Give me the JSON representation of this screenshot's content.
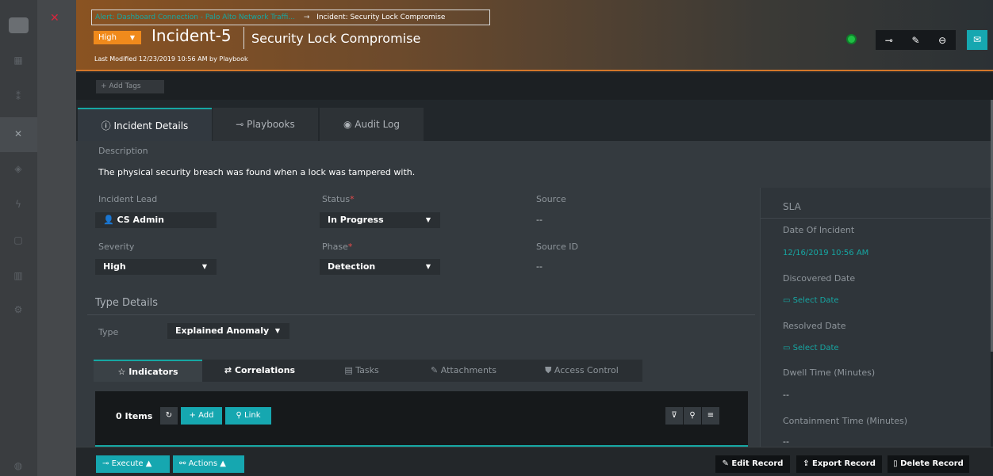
{
  "breadcrumb": {
    "link_text": "Alert: Dashboard Connection - Palo Alto Network Traffi...",
    "arrow": "→",
    "current": "Incident: Security Lock Compromise"
  },
  "header": {
    "severity": "High",
    "incident_id": "Incident-5",
    "incident_title": "Security Lock Compromise",
    "last_modified": "Last Modified 12/23/2019 10:56 AM by Playbook",
    "status_color": "#1fbf44"
  },
  "tags": {
    "add_label": "+ Add Tags"
  },
  "tabs": [
    {
      "label": "Incident Details",
      "icon": "info-icon"
    },
    {
      "label": "Playbooks",
      "icon": "playbook-icon"
    },
    {
      "label": "Audit Log",
      "icon": "eye-icon"
    }
  ],
  "details": {
    "description_label": "Description",
    "description": "The physical security breach was found when a lock was tampered with.",
    "incident_lead_label": "Incident Lead",
    "incident_lead": "CS Admin",
    "status_label": "Status",
    "status": "In Progress",
    "source_label": "Source",
    "source": "--",
    "severity_label": "Severity",
    "severity": "High",
    "phase_label": "Phase",
    "phase": "Detection",
    "source_id_label": "Source ID",
    "source_id": "--",
    "type_details_label": "Type Details",
    "type_label": "Type",
    "type": "Explained Anomaly",
    "required_mark": "*"
  },
  "sla": {
    "title": "SLA",
    "date_of_incident_label": "Date Of Incident",
    "date_of_incident": "12/16/2019 10:56 AM",
    "discovered_label": "Discovered Date",
    "discovered": "Select Date",
    "resolved_label": "Resolved Date",
    "resolved": "Select Date",
    "dwell_label": "Dwell Time (Minutes)",
    "dwell": "--",
    "containment_label": "Containment Time (Minutes)",
    "containment": "--"
  },
  "subtabs": [
    {
      "label": "Indicators"
    },
    {
      "label": "Correlations"
    },
    {
      "label": "Tasks"
    },
    {
      "label": "Attachments"
    },
    {
      "label": "Access Control"
    }
  ],
  "grid": {
    "count": "0 Items",
    "add_label": "+ Add",
    "link_label": "Link"
  },
  "footer": {
    "execute": "Execute",
    "actions": "Actions",
    "edit": "Edit Record",
    "export": "Export Record",
    "delete": "Delete Record"
  },
  "colors": {
    "accent": "#16a7a3",
    "severity": "#f08a1c",
    "header_border": "#d3772a"
  }
}
